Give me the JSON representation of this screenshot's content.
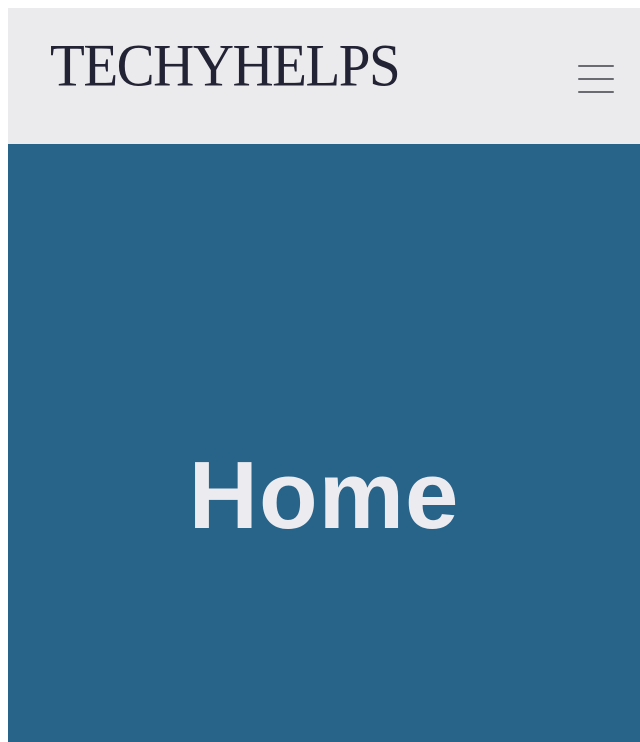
{
  "header": {
    "logo_text": "TECHYHELPS",
    "menu_icon": "hamburger-menu-icon"
  },
  "hero": {
    "title": "Home"
  },
  "colors": {
    "header_background": "#ebebed",
    "hero_background": "#28638a",
    "hero_text": "#ececf0",
    "logo_text": "#232336"
  }
}
